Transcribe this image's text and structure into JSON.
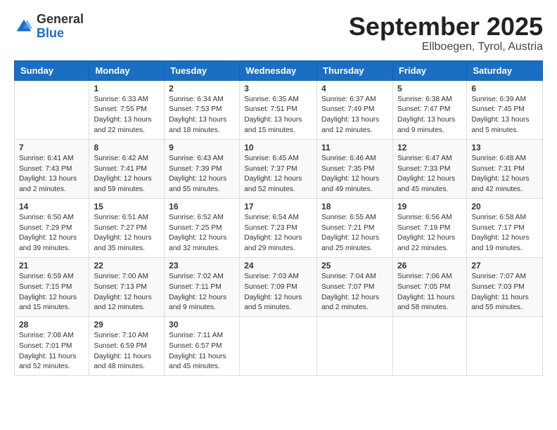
{
  "header": {
    "logo_general": "General",
    "logo_blue": "Blue",
    "month_title": "September 2025",
    "location": "Ellboegen, Tyrol, Austria"
  },
  "days_of_week": [
    "Sunday",
    "Monday",
    "Tuesday",
    "Wednesday",
    "Thursday",
    "Friday",
    "Saturday"
  ],
  "weeks": [
    [
      {
        "day": "",
        "info": ""
      },
      {
        "day": "1",
        "info": "Sunrise: 6:33 AM\nSunset: 7:55 PM\nDaylight: 13 hours\nand 22 minutes."
      },
      {
        "day": "2",
        "info": "Sunrise: 6:34 AM\nSunset: 7:53 PM\nDaylight: 13 hours\nand 18 minutes."
      },
      {
        "day": "3",
        "info": "Sunrise: 6:35 AM\nSunset: 7:51 PM\nDaylight: 13 hours\nand 15 minutes."
      },
      {
        "day": "4",
        "info": "Sunrise: 6:37 AM\nSunset: 7:49 PM\nDaylight: 13 hours\nand 12 minutes."
      },
      {
        "day": "5",
        "info": "Sunrise: 6:38 AM\nSunset: 7:47 PM\nDaylight: 13 hours\nand 9 minutes."
      },
      {
        "day": "6",
        "info": "Sunrise: 6:39 AM\nSunset: 7:45 PM\nDaylight: 13 hours\nand 5 minutes."
      }
    ],
    [
      {
        "day": "7",
        "info": "Sunrise: 6:41 AM\nSunset: 7:43 PM\nDaylight: 13 hours\nand 2 minutes."
      },
      {
        "day": "8",
        "info": "Sunrise: 6:42 AM\nSunset: 7:41 PM\nDaylight: 12 hours\nand 59 minutes."
      },
      {
        "day": "9",
        "info": "Sunrise: 6:43 AM\nSunset: 7:39 PM\nDaylight: 12 hours\nand 55 minutes."
      },
      {
        "day": "10",
        "info": "Sunrise: 6:45 AM\nSunset: 7:37 PM\nDaylight: 12 hours\nand 52 minutes."
      },
      {
        "day": "11",
        "info": "Sunrise: 6:46 AM\nSunset: 7:35 PM\nDaylight: 12 hours\nand 49 minutes."
      },
      {
        "day": "12",
        "info": "Sunrise: 6:47 AM\nSunset: 7:33 PM\nDaylight: 12 hours\nand 45 minutes."
      },
      {
        "day": "13",
        "info": "Sunrise: 6:48 AM\nSunset: 7:31 PM\nDaylight: 12 hours\nand 42 minutes."
      }
    ],
    [
      {
        "day": "14",
        "info": "Sunrise: 6:50 AM\nSunset: 7:29 PM\nDaylight: 12 hours\nand 39 minutes."
      },
      {
        "day": "15",
        "info": "Sunrise: 6:51 AM\nSunset: 7:27 PM\nDaylight: 12 hours\nand 35 minutes."
      },
      {
        "day": "16",
        "info": "Sunrise: 6:52 AM\nSunset: 7:25 PM\nDaylight: 12 hours\nand 32 minutes."
      },
      {
        "day": "17",
        "info": "Sunrise: 6:54 AM\nSunset: 7:23 PM\nDaylight: 12 hours\nand 29 minutes."
      },
      {
        "day": "18",
        "info": "Sunrise: 6:55 AM\nSunset: 7:21 PM\nDaylight: 12 hours\nand 25 minutes."
      },
      {
        "day": "19",
        "info": "Sunrise: 6:56 AM\nSunset: 7:19 PM\nDaylight: 12 hours\nand 22 minutes."
      },
      {
        "day": "20",
        "info": "Sunrise: 6:58 AM\nSunset: 7:17 PM\nDaylight: 12 hours\nand 19 minutes."
      }
    ],
    [
      {
        "day": "21",
        "info": "Sunrise: 6:59 AM\nSunset: 7:15 PM\nDaylight: 12 hours\nand 15 minutes."
      },
      {
        "day": "22",
        "info": "Sunrise: 7:00 AM\nSunset: 7:13 PM\nDaylight: 12 hours\nand 12 minutes."
      },
      {
        "day": "23",
        "info": "Sunrise: 7:02 AM\nSunset: 7:11 PM\nDaylight: 12 hours\nand 9 minutes."
      },
      {
        "day": "24",
        "info": "Sunrise: 7:03 AM\nSunset: 7:09 PM\nDaylight: 12 hours\nand 5 minutes."
      },
      {
        "day": "25",
        "info": "Sunrise: 7:04 AM\nSunset: 7:07 PM\nDaylight: 12 hours\nand 2 minutes."
      },
      {
        "day": "26",
        "info": "Sunrise: 7:06 AM\nSunset: 7:05 PM\nDaylight: 11 hours\nand 58 minutes."
      },
      {
        "day": "27",
        "info": "Sunrise: 7:07 AM\nSunset: 7:03 PM\nDaylight: 11 hours\nand 55 minutes."
      }
    ],
    [
      {
        "day": "28",
        "info": "Sunrise: 7:08 AM\nSunset: 7:01 PM\nDaylight: 11 hours\nand 52 minutes."
      },
      {
        "day": "29",
        "info": "Sunrise: 7:10 AM\nSunset: 6:59 PM\nDaylight: 11 hours\nand 48 minutes."
      },
      {
        "day": "30",
        "info": "Sunrise: 7:11 AM\nSunset: 6:57 PM\nDaylight: 11 hours\nand 45 minutes."
      },
      {
        "day": "",
        "info": ""
      },
      {
        "day": "",
        "info": ""
      },
      {
        "day": "",
        "info": ""
      },
      {
        "day": "",
        "info": ""
      }
    ]
  ]
}
